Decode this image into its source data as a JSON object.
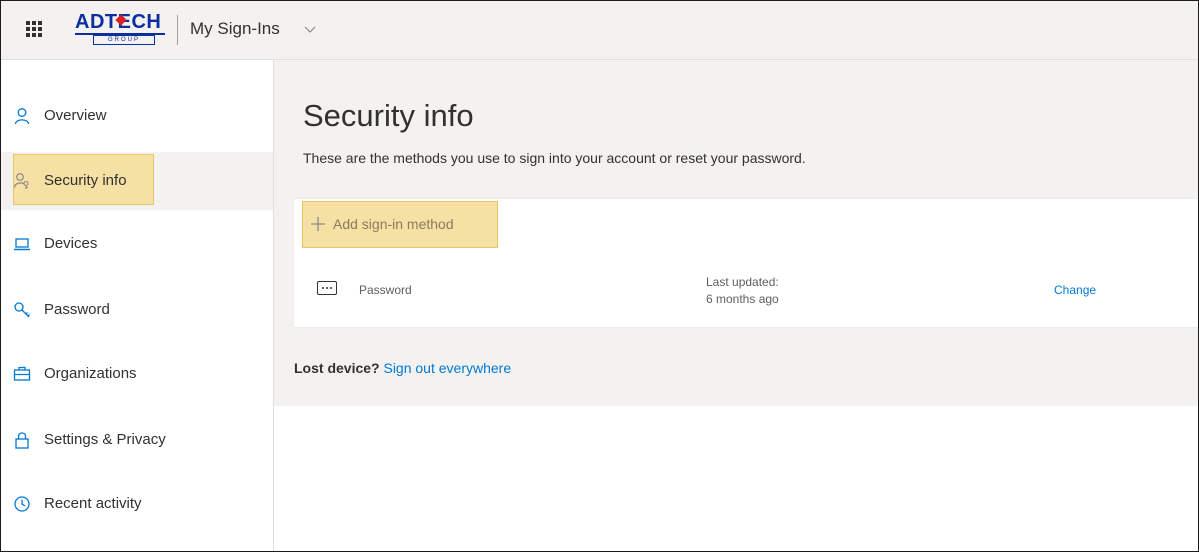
{
  "header": {
    "logo_text": "ADTECH",
    "logo_sub": "GROUP",
    "app_title": "My Sign-Ins"
  },
  "sidebar": {
    "items": [
      {
        "label": "Overview",
        "icon": "person-icon"
      },
      {
        "label": "Security info",
        "icon": "person-key-icon",
        "active": true
      },
      {
        "label": "Devices",
        "icon": "laptop-icon"
      },
      {
        "label": "Password",
        "icon": "key-icon"
      },
      {
        "label": "Organizations",
        "icon": "briefcase-icon"
      },
      {
        "label": "Settings & Privacy",
        "icon": "lock-icon"
      },
      {
        "label": "Recent activity",
        "icon": "history-icon"
      }
    ]
  },
  "main": {
    "title": "Security info",
    "description": "These are the methods you use to sign into your account or reset your password.",
    "add_method_label": "Add sign-in method",
    "methods": [
      {
        "name": "Password",
        "last_updated_label": "Last updated:",
        "last_updated_value": "6 months ago",
        "action_label": "Change"
      }
    ],
    "lost_device_question": "Lost device?",
    "sign_out_link": "Sign out everywhere"
  },
  "colors": {
    "accent": "#0078d4",
    "highlight": "#f6e1a4",
    "background": "#f3f2f1",
    "brand": "#0d2f9e"
  }
}
